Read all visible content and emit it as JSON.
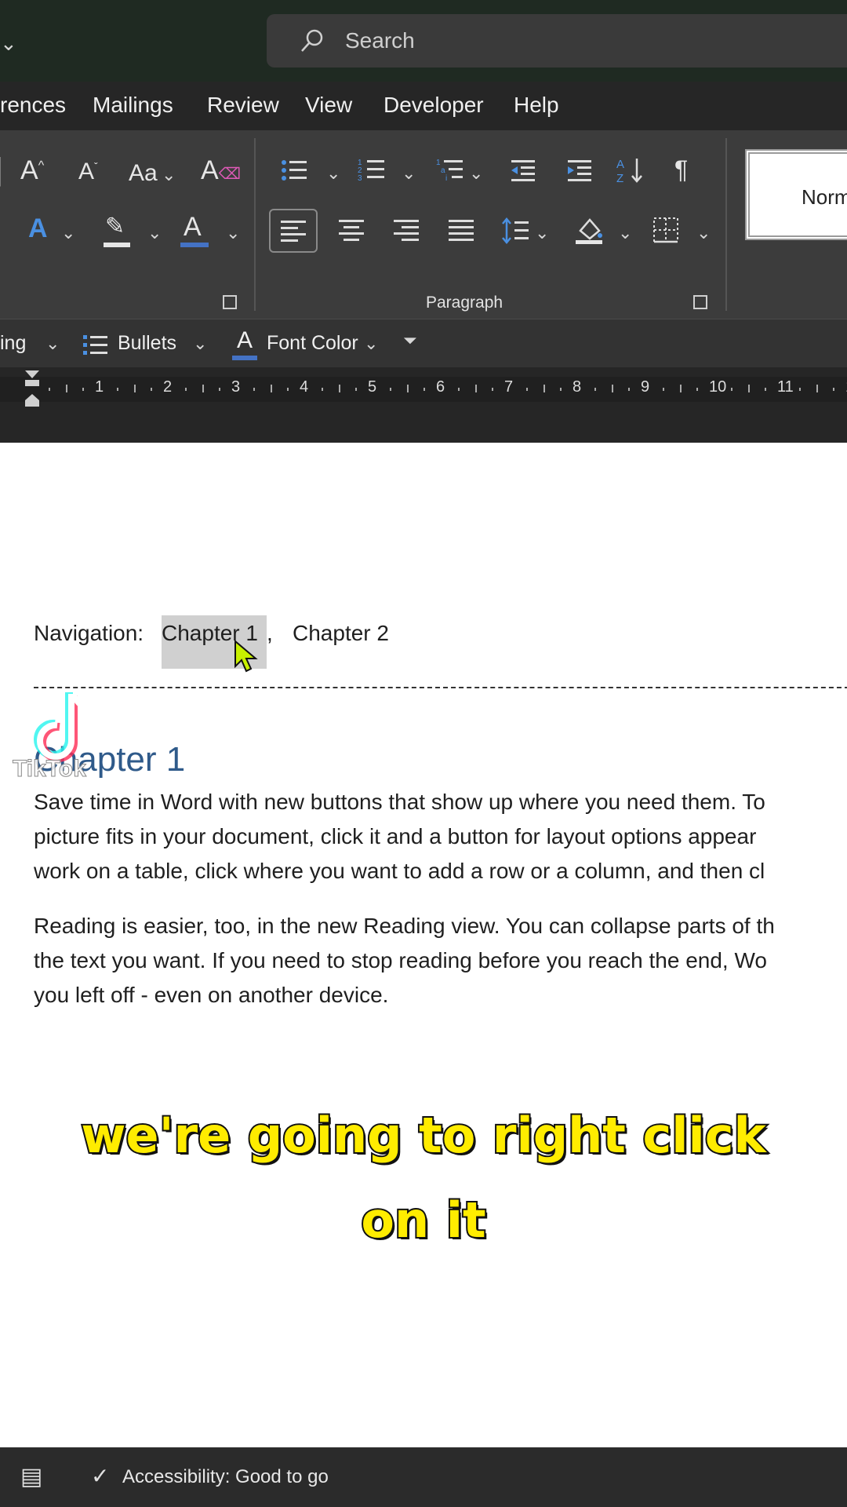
{
  "title_bar": {
    "search_placeholder": "Search"
  },
  "menu": {
    "tabs": [
      "rences",
      "Mailings",
      "Review",
      "View",
      "Developer",
      "Help"
    ]
  },
  "ribbon": {
    "paragraph_group_label": "Paragraph",
    "style_preview": "Norm",
    "quick_access": {
      "heading_partial": "ing",
      "bullets_label": "Bullets",
      "font_color_label": "Font Color"
    }
  },
  "ruler": {
    "numbers": [
      "1",
      "2",
      "3",
      "4",
      "5",
      "6",
      "7",
      "8",
      "9",
      "10",
      "11",
      "1"
    ]
  },
  "document": {
    "nav_prefix": "Navigation:",
    "nav_link1": "Chapter 1",
    "nav_comma": ",",
    "nav_link2": "Chapter 2",
    "heading": "Chapter 1",
    "para1_lines": [
      "Save time in Word with new buttons that show up where you need them. To",
      "picture fits in your document, click it and a button for layout options appear",
      "work on a table, click where you want to add a row or a column, and then cl"
    ],
    "para2_lines": [
      "Reading is easier, too, in the new Reading view. You can collapse parts of th",
      "the text you want. If you need to stop reading before you reach the end, Wo",
      "you left off - even on another device."
    ]
  },
  "caption": {
    "line1": "we're going to right click",
    "line2": "on it"
  },
  "watermark": {
    "text": "TikTok"
  },
  "status_bar": {
    "accessibility": "Accessibility: Good to go"
  },
  "colors": {
    "heading": "#2f5a8a",
    "caption_fill": "#ffec00",
    "cursor": "#c8f000",
    "font_color_underline": "#4472c4"
  }
}
